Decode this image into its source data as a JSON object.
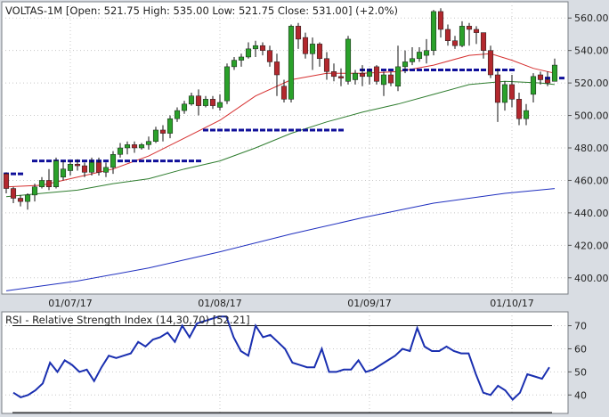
{
  "main_chart": {
    "header": {
      "symbol": "VOLTAS-1M",
      "open_label": "Open:",
      "open": "521.75",
      "high_label": "High:",
      "high": "535.00",
      "low_label": "Low:",
      "low": "521.75",
      "close_label": "Close:",
      "close": "531.00",
      "change": "(+2.0%)"
    },
    "colors": {
      "bull": "#2aa12a",
      "bear": "#b3282e",
      "wick": "#111111",
      "sma_red": "#d63030",
      "sma_green": "#2f7d2f",
      "sma_blue": "#1f2fbf",
      "level": "#10109a",
      "grid": "#c8c8c8"
    }
  },
  "rsi_chart": {
    "header": "RSI - Relative Strength Index (14,30,70) [52.21]",
    "line_color": "#1a2fb0"
  },
  "chart_data": [
    {
      "type": "candlestick",
      "ylim": [
        390,
        570
      ],
      "yticks": [
        400,
        420,
        440,
        460,
        480,
        500,
        520,
        540,
        560
      ],
      "xtick_labels": [
        {
          "label": "01/07/17",
          "index": 9
        },
        {
          "label": "01/08/17",
          "index": 30
        },
        {
          "label": "01/09/17",
          "index": 51
        },
        {
          "label": "01/10/17",
          "index": 71
        }
      ],
      "candles": [
        [
          464,
          465,
          452,
          455
        ],
        [
          455,
          456,
          446,
          449
        ],
        [
          449,
          451,
          444,
          447
        ],
        [
          447,
          452,
          442,
          451
        ],
        [
          451,
          458,
          447,
          456
        ],
        [
          456,
          462,
          455,
          460
        ],
        [
          460,
          467,
          454,
          456
        ],
        [
          456,
          474,
          455,
          472
        ],
        [
          462,
          472,
          460,
          467
        ],
        [
          466,
          472,
          463,
          470
        ],
        [
          470,
          473,
          466,
          469
        ],
        [
          469,
          471,
          462,
          465
        ],
        [
          465,
          474,
          463,
          471
        ],
        [
          471,
          474,
          463,
          465
        ],
        [
          465,
          471,
          462,
          468
        ],
        [
          468,
          478,
          464,
          476
        ],
        [
          476,
          483,
          474,
          480
        ],
        [
          480,
          484,
          476,
          482
        ],
        [
          482,
          484,
          477,
          480
        ],
        [
          480,
          483,
          479,
          482
        ],
        [
          482,
          487,
          479,
          484
        ],
        [
          484,
          493,
          483,
          491
        ],
        [
          491,
          494,
          484,
          489
        ],
        [
          489,
          500,
          486,
          498
        ],
        [
          498,
          505,
          496,
          503
        ],
        [
          503,
          509,
          501,
          507
        ],
        [
          507,
          514,
          506,
          512
        ],
        [
          512,
          516,
          500,
          506
        ],
        [
          506,
          512,
          505,
          510
        ],
        [
          510,
          512,
          504,
          506
        ],
        [
          505,
          513,
          503,
          508
        ],
        [
          509,
          532,
          507,
          530
        ],
        [
          530,
          536,
          528,
          534
        ],
        [
          534,
          538,
          530,
          536
        ],
        [
          536,
          545,
          535,
          541
        ],
        [
          541,
          546,
          536,
          543
        ],
        [
          543,
          545,
          537,
          540
        ],
        [
          540,
          543,
          530,
          533
        ],
        [
          533,
          538,
          512,
          525
        ],
        [
          518,
          522,
          508,
          510
        ],
        [
          510,
          556,
          508,
          555
        ],
        [
          555,
          557,
          541,
          547
        ],
        [
          548,
          551,
          535,
          538
        ],
        [
          538,
          548,
          528,
          544
        ],
        [
          544,
          545,
          530,
          535
        ],
        [
          535,
          539,
          522,
          527
        ],
        [
          527,
          532,
          521,
          524
        ],
        [
          524,
          529,
          518,
          523
        ],
        [
          521,
          549,
          519,
          547
        ],
        [
          522,
          528,
          519,
          526
        ],
        [
          526,
          531,
          518,
          524
        ],
        [
          524,
          529,
          519,
          527
        ],
        [
          530,
          531,
          519,
          521
        ],
        [
          519,
          527,
          512,
          525
        ],
        [
          525,
          527,
          518,
          520
        ],
        [
          518,
          543,
          515,
          530
        ],
        [
          530,
          540,
          526,
          533
        ],
        [
          533,
          542,
          531,
          535
        ],
        [
          535,
          542,
          533,
          539
        ],
        [
          537,
          547,
          532,
          540
        ],
        [
          540,
          565,
          537,
          564
        ],
        [
          564,
          566,
          548,
          553
        ],
        [
          553,
          556,
          543,
          546
        ],
        [
          546,
          549,
          541,
          543
        ],
        [
          543,
          558,
          542,
          555
        ],
        [
          555,
          557,
          543,
          553
        ],
        [
          553,
          555,
          544,
          551
        ],
        [
          551,
          551,
          535,
          540
        ],
        [
          540,
          543,
          523,
          525
        ],
        [
          525,
          529,
          496,
          508
        ],
        [
          508,
          521,
          503,
          519
        ],
        [
          519,
          525,
          505,
          510
        ],
        [
          510,
          514,
          494,
          498
        ],
        [
          498,
          507,
          494,
          503
        ],
        [
          513,
          526,
          508,
          524
        ],
        [
          525,
          527,
          519,
          522
        ],
        [
          522,
          527,
          518,
          520
        ],
        [
          521,
          535,
          521,
          531
        ]
      ],
      "ma_red": [
        [
          0,
          456
        ],
        [
          5,
          457
        ],
        [
          10,
          462
        ],
        [
          15,
          467
        ],
        [
          20,
          475
        ],
        [
          25,
          486
        ],
        [
          30,
          497
        ],
        [
          35,
          512
        ],
        [
          40,
          522
        ],
        [
          45,
          526
        ],
        [
          50,
          526
        ],
        [
          55,
          527
        ],
        [
          60,
          531
        ],
        [
          65,
          537
        ],
        [
          68,
          538
        ],
        [
          71,
          534
        ],
        [
          74,
          529
        ],
        [
          77,
          526
        ]
      ],
      "ma_green": [
        [
          0,
          450
        ],
        [
          5,
          452
        ],
        [
          10,
          454
        ],
        [
          15,
          458
        ],
        [
          20,
          461
        ],
        [
          25,
          467
        ],
        [
          30,
          472
        ],
        [
          35,
          480
        ],
        [
          40,
          489
        ],
        [
          45,
          496
        ],
        [
          50,
          502
        ],
        [
          55,
          507
        ],
        [
          60,
          513
        ],
        [
          65,
          519
        ],
        [
          70,
          521
        ],
        [
          75,
          520
        ],
        [
          77,
          519
        ]
      ],
      "ma_blue": [
        [
          0,
          392
        ],
        [
          10,
          398
        ],
        [
          20,
          406
        ],
        [
          30,
          416
        ],
        [
          40,
          427
        ],
        [
          50,
          437
        ],
        [
          60,
          446
        ],
        [
          70,
          452
        ],
        [
          77,
          455
        ]
      ],
      "levels": [
        {
          "y": 464,
          "from": 0,
          "to": 2
        },
        {
          "y": 472,
          "from": 4,
          "to": 27
        },
        {
          "y": 491,
          "from": 28,
          "to": 47
        },
        {
          "y": 528,
          "from": 50,
          "to": 71
        },
        {
          "y": 523,
          "from": 74,
          "to": 78
        }
      ]
    },
    {
      "type": "line",
      "ylim": [
        32,
        76
      ],
      "yticks": [
        40,
        50,
        60,
        70
      ],
      "reference_lines": [
        30,
        70
      ],
      "values": [
        41,
        39,
        40,
        42,
        45,
        54,
        50,
        55,
        53,
        50,
        51,
        46,
        52,
        57,
        56,
        57,
        58,
        63,
        61,
        64,
        65,
        67,
        63,
        70,
        65,
        71,
        72,
        73,
        74,
        74,
        65,
        59,
        57,
        70,
        65,
        66,
        63,
        60,
        54,
        53,
        52,
        52,
        60,
        50,
        50,
        51,
        51,
        55,
        50,
        51,
        53,
        55,
        57,
        60,
        59,
        69,
        61,
        59,
        59,
        61,
        59,
        58,
        58,
        49,
        41,
        40,
        44,
        42,
        38,
        41,
        49,
        48,
        47,
        52
      ]
    }
  ]
}
